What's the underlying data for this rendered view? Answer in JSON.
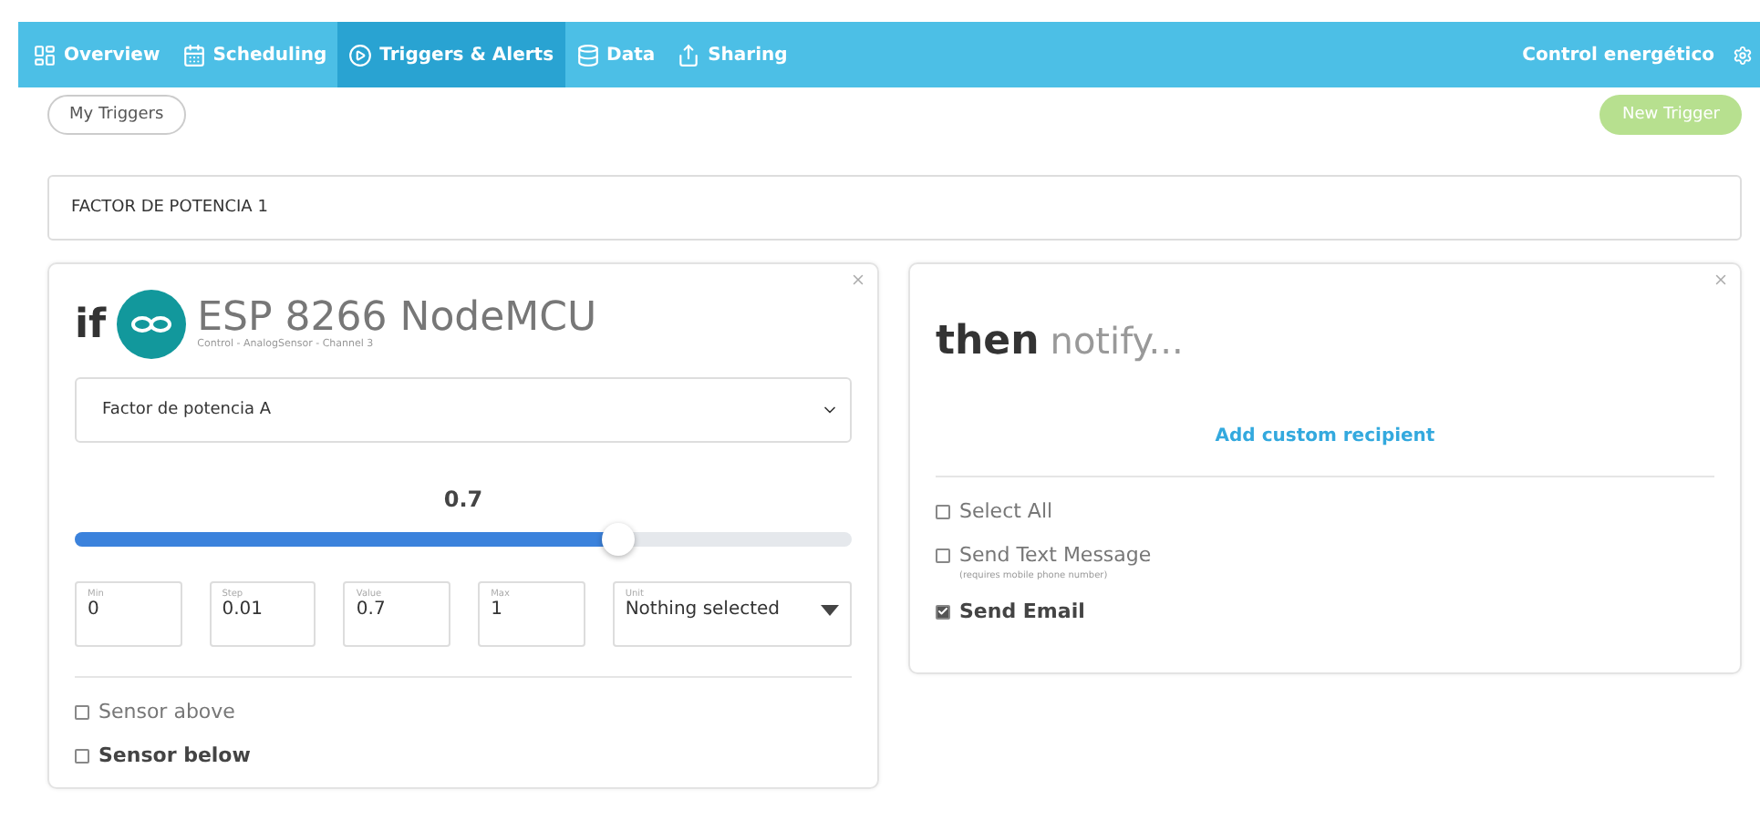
{
  "nav": {
    "tabs": [
      {
        "label": "Overview",
        "selected": false
      },
      {
        "label": "Scheduling",
        "selected": false
      },
      {
        "label": "Triggers & Alerts",
        "selected": true
      },
      {
        "label": "Data",
        "selected": false
      },
      {
        "label": "Sharing",
        "selected": false
      }
    ],
    "project": "Control energético"
  },
  "toolbar": {
    "my_triggers": "My Triggers",
    "new_trigger": "New Trigger",
    "new_trigger_disabled": true
  },
  "trigger_name": "FACTOR DE POTENCIA 1",
  "if_panel": {
    "keyword": "if",
    "device": "ESP 8266 NodeMCU",
    "path": "Control - AnalogSensor - Channel 3",
    "channel": "Factor de potencia A",
    "reading": "0.7",
    "level": 0.7,
    "fields": [
      {
        "label": "Min",
        "value": "0"
      },
      {
        "label": "Step",
        "value": "0.01"
      },
      {
        "label": "Value",
        "value": "0.7"
      },
      {
        "label": "Max",
        "value": "1"
      }
    ],
    "unit": {
      "label": "Unit",
      "value": "Nothing selected"
    },
    "options": [
      {
        "label": "Sensor above",
        "checked": false,
        "highlighted": false
      },
      {
        "label": "Sensor below",
        "checked": false,
        "highlighted": true
      }
    ]
  },
  "then_panel": {
    "keyword": "then",
    "action": "notify...",
    "link": "Add custom recipient",
    "options": [
      {
        "label": "Select All",
        "checked": false
      },
      {
        "label": "Send Text Message",
        "note": "(requires mobile phone number)",
        "checked": false
      },
      {
        "label": "Send Email",
        "checked": true
      }
    ]
  }
}
